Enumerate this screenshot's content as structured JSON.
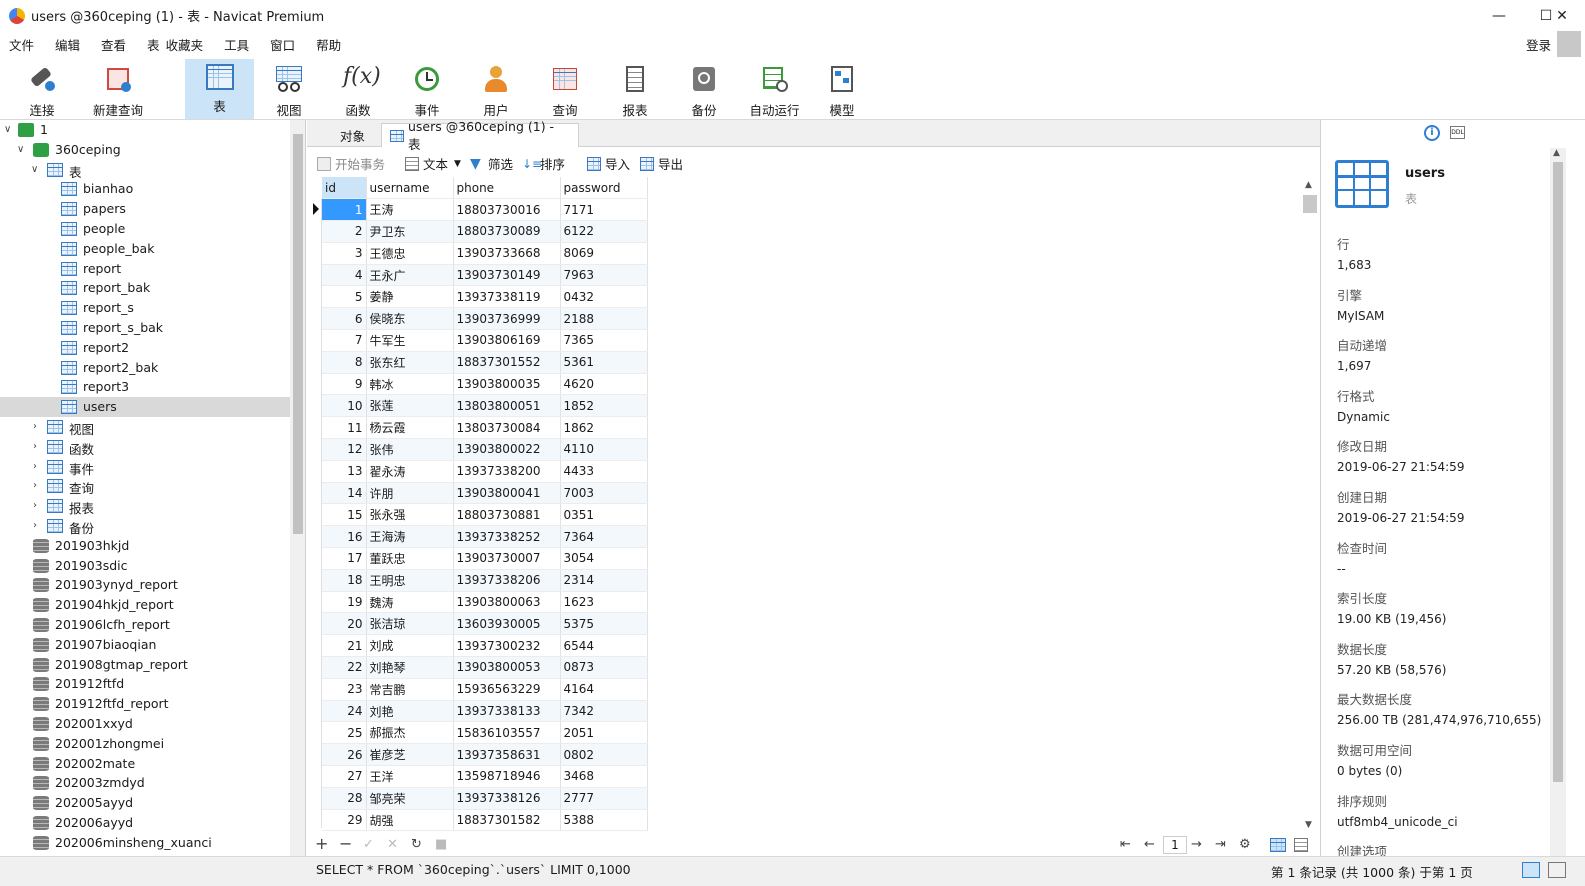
{
  "window": {
    "title": "users @360ceping (1) - 表 - Navicat Premium",
    "minimize": "—",
    "maximize": "☐",
    "close": "✕"
  },
  "menu": {
    "items": [
      "文件",
      "编辑",
      "查看",
      "表",
      "收藏夹",
      "工具",
      "窗口",
      "帮助"
    ],
    "login": "登录"
  },
  "toolbar": {
    "items": [
      {
        "label": "连接",
        "icon": "plug-icon"
      },
      {
        "label": "新建查询",
        "icon": "new-query-icon"
      },
      {
        "label": "表",
        "icon": "table-icon"
      },
      {
        "label": "视图",
        "icon": "view-icon"
      },
      {
        "label": "函数",
        "icon": "function-icon"
      },
      {
        "label": "事件",
        "icon": "clock-icon"
      },
      {
        "label": "用户",
        "icon": "user-icon"
      },
      {
        "label": "查询",
        "icon": "query-icon"
      },
      {
        "label": "报表",
        "icon": "report-icon"
      },
      {
        "label": "备份",
        "icon": "backup-icon"
      },
      {
        "label": "自动运行",
        "icon": "autorun-icon"
      },
      {
        "label": "模型",
        "icon": "model-icon"
      }
    ],
    "active": "表"
  },
  "tree": {
    "connection": "1",
    "database": "360ceping",
    "tables_group": "表",
    "tables": [
      "bianhao",
      "papers",
      "people",
      "people_bak",
      "report",
      "report_bak",
      "report_s",
      "report_s_bak",
      "report2",
      "report2_bak",
      "report3",
      "users"
    ],
    "selected_table": "users",
    "groups": [
      "视图",
      "函数",
      "事件",
      "查询",
      "报表",
      "备份"
    ],
    "other_databases": [
      "201903hkjd",
      "201903sdic",
      "201903ynyd_report",
      "201904hkjd_report",
      "201906lcfh_report",
      "201907biaoqian",
      "201908gtmap_report",
      "201912ftfd",
      "201912ftfd_report",
      "202001xxyd",
      "202001zhongmei",
      "202002mate",
      "202003zmdyd",
      "202005ayyd",
      "202006ayyd",
      "202006minsheng_xuanci"
    ]
  },
  "tabs": {
    "objects": "对象",
    "active": "users @360ceping (1) - 表"
  },
  "grid_toolbar": {
    "begin_tx": "开始事务",
    "text": "文本",
    "filter": "筛选",
    "sort": "排序",
    "import": "导入",
    "export": "导出"
  },
  "grid": {
    "columns": [
      "id",
      "username",
      "phone",
      "password"
    ],
    "rows": [
      [
        "1",
        "王涛",
        "18803730016",
        "7171"
      ],
      [
        "2",
        "尹卫东",
        "18803730089",
        "6122"
      ],
      [
        "3",
        "王德忠",
        "13903733668",
        "8069"
      ],
      [
        "4",
        "王永广",
        "13903730149",
        "7963"
      ],
      [
        "5",
        "姜静",
        "13937338119",
        "0432"
      ],
      [
        "6",
        "侯晓东",
        "13903736999",
        "2188"
      ],
      [
        "7",
        "牛军生",
        "13903806169",
        "7365"
      ],
      [
        "8",
        "张东红",
        "18837301552",
        "5361"
      ],
      [
        "9",
        "韩冰",
        "13903800035",
        "4620"
      ],
      [
        "10",
        "张莲",
        "13803800051",
        "1852"
      ],
      [
        "11",
        "杨云霞",
        "13803730084",
        "1862"
      ],
      [
        "12",
        "张伟",
        "13903800022",
        "4110"
      ],
      [
        "13",
        "翟永涛",
        "13937338200",
        "4433"
      ],
      [
        "14",
        "许朋",
        "13903800041",
        "7003"
      ],
      [
        "15",
        "张永强",
        "18803730881",
        "0351"
      ],
      [
        "16",
        "王海涛",
        "13937338252",
        "7364"
      ],
      [
        "17",
        "董跃忠",
        "13903730007",
        "3054"
      ],
      [
        "18",
        "王明忠",
        "13937338206",
        "2314"
      ],
      [
        "19",
        "魏涛",
        "13903800063",
        "1623"
      ],
      [
        "20",
        "张洁琼",
        "13603930005",
        "5375"
      ],
      [
        "21",
        "刘成",
        "13937300232",
        "6544"
      ],
      [
        "22",
        "刘艳琴",
        "13903800053",
        "0873"
      ],
      [
        "23",
        "常吉鹏",
        "15936563229",
        "4164"
      ],
      [
        "24",
        "刘艳",
        "13937338133",
        "7342"
      ],
      [
        "25",
        "郝振杰",
        "15836103557",
        "2051"
      ],
      [
        "26",
        "崔彦芝",
        "13937358631",
        "0802"
      ],
      [
        "27",
        "王洋",
        "13598718946",
        "3468"
      ],
      [
        "28",
        "邹亮荣",
        "13937338126",
        "2777"
      ],
      [
        "29",
        "胡强",
        "18837301582",
        "5388"
      ]
    ]
  },
  "pager": {
    "page": "1"
  },
  "status": {
    "sql": "SELECT * FROM `360ceping`.`users` LIMIT 0,1000",
    "records": "第 1 条记录 (共 1000 条) 于第 1 页"
  },
  "info": {
    "name": "users",
    "type": "表",
    "props": [
      {
        "label": "行",
        "value": "1,683"
      },
      {
        "label": "引擎",
        "value": "MyISAM"
      },
      {
        "label": "自动递增",
        "value": "1,697"
      },
      {
        "label": "行格式",
        "value": "Dynamic"
      },
      {
        "label": "修改日期",
        "value": "2019-06-27 21:54:59"
      },
      {
        "label": "创建日期",
        "value": "2019-06-27 21:54:59"
      },
      {
        "label": "检查时间",
        "value": "--"
      },
      {
        "label": "索引长度",
        "value": "19.00 KB (19,456)"
      },
      {
        "label": "数据长度",
        "value": "57.20 KB (58,576)"
      },
      {
        "label": "最大数据长度",
        "value": "256.00 TB (281,474,976,710,655)"
      },
      {
        "label": "数据可用空间",
        "value": "0 bytes (0)"
      },
      {
        "label": "排序规则",
        "value": "utf8mb4_unicode_ci"
      },
      {
        "label": "创建选项",
        "value": ""
      }
    ]
  }
}
